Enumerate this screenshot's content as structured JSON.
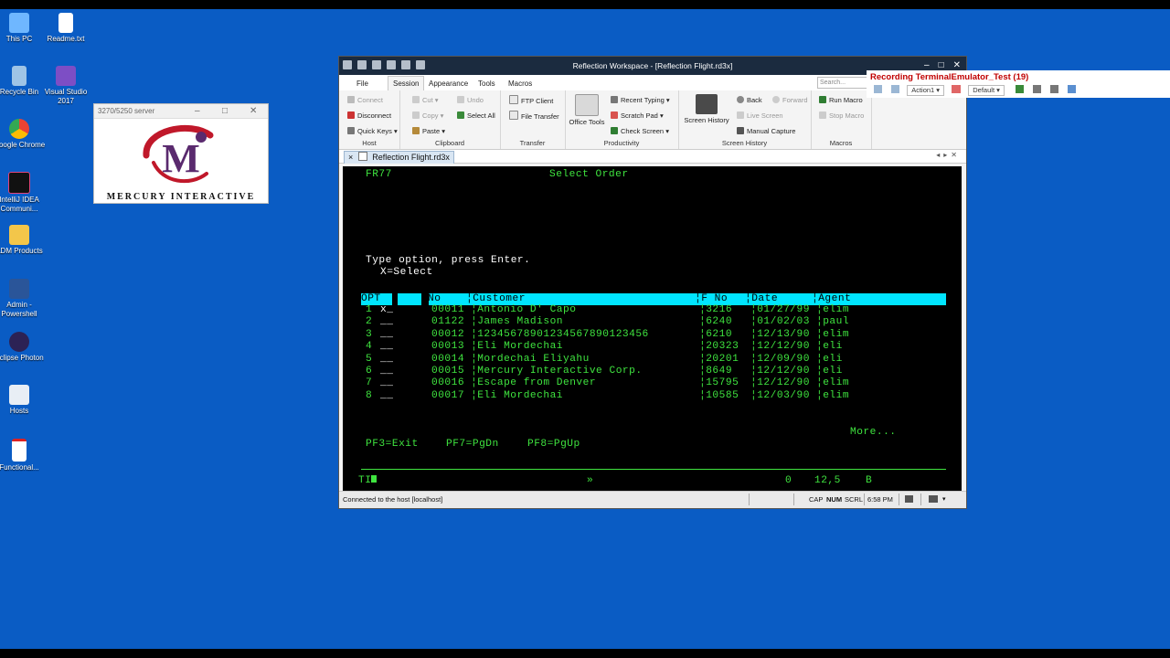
{
  "desktop": {
    "icons": [
      {
        "label": "This PC"
      },
      {
        "label": "Readme.txt"
      },
      {
        "label": "Recycle Bin"
      },
      {
        "label": "Visual Studio 2017"
      },
      {
        "label": "Google Chrome"
      },
      {
        "label": "IntelliJ IDEA Communi..."
      },
      {
        "label": "ADM Products"
      },
      {
        "label": "Admin - Powershell"
      },
      {
        "label": "Eclipse Photon"
      },
      {
        "label": "Hosts"
      },
      {
        "label": "Functional..."
      }
    ],
    "colors": {
      "background": "#0a5cc4"
    }
  },
  "splash": {
    "caption": "3270/5250 server",
    "brand": "MERCURY INTERACTIVE",
    "logo_letter": "M"
  },
  "window": {
    "title": "Reflection Workspace - [Reflection Flight.rd3x]",
    "controls": {
      "minimize": "–",
      "maximize": "□",
      "close": "✕"
    },
    "menu_tabs": [
      {
        "label": "File"
      },
      {
        "label": "Session"
      },
      {
        "label": "Appearance"
      },
      {
        "label": "Tools"
      },
      {
        "label": "Macros"
      }
    ],
    "active_tab": "Session",
    "search_placeholder": "Search..."
  },
  "ribbon": {
    "host": {
      "label": "Host",
      "connect": "Connect",
      "disconnect": "Disconnect",
      "quick_keys": "Quick Keys"
    },
    "clipboard": {
      "label": "Clipboard",
      "cut": "Cut",
      "copy": "Copy",
      "paste": "Paste",
      "undo": "Undo",
      "select_all": "Select All"
    },
    "transfer": {
      "label": "Transfer",
      "ftp_client": "FTP Client",
      "file_transfer": "File Transfer"
    },
    "productivity": {
      "label": "Productivity",
      "office_tools": "Office Tools",
      "recent_typing": "Recent Typing",
      "scratch_pad": "Scratch Pad",
      "check_screen": "Check Screen"
    },
    "screen_history": {
      "label": "Screen History",
      "screen_history_btn": "Screen History",
      "back": "Back",
      "forward": "Forward",
      "live_screen": "Live Screen",
      "manual_capture": "Manual Capture"
    },
    "macros": {
      "label": "Macros",
      "run_macro": "Run Macro",
      "stop_macro": "Stop Macro"
    }
  },
  "document_tab": {
    "label": "Reflection Flight.rd3x",
    "close": "×"
  },
  "terminal": {
    "screen_id": "FR77",
    "screen_title": "Select Order",
    "instruction": "Type option, press Enter.",
    "option_hint": "X=Select",
    "columns": {
      "opt": "OPT",
      "no": "No",
      "customer": "¦Customer",
      "fno": "¦F No",
      "date": "¦Date",
      "agent": "¦Agent"
    },
    "rows": [
      {
        "num": "1",
        "opt": "x_",
        "no": "00011",
        "customer": "¦Antonio D' Capo",
        "fno": "¦3216",
        "date": "¦01/27/99",
        "agent": "¦elim"
      },
      {
        "num": "2",
        "opt": "__",
        "no": "01122",
        "customer": "¦James Madison",
        "fno": "¦6240",
        "date": "¦01/02/03",
        "agent": "¦paul"
      },
      {
        "num": "3",
        "opt": "__",
        "no": "00012",
        "customer": "¦12345678901234567890123456",
        "fno": "¦6210",
        "date": "¦12/13/90",
        "agent": "¦elim"
      },
      {
        "num": "4",
        "opt": "__",
        "no": "00013",
        "customer": "¦Eli Mordechai",
        "fno": "¦20323",
        "date": "¦12/12/90",
        "agent": "¦eli"
      },
      {
        "num": "5",
        "opt": "__",
        "no": "00014",
        "customer": "¦Mordechai Eliyahu",
        "fno": "¦20201",
        "date": "¦12/09/90",
        "agent": "¦eli"
      },
      {
        "num": "6",
        "opt": "__",
        "no": "00015",
        "customer": "¦Mercury Interactive Corp.",
        "fno": "¦8649",
        "date": "¦12/12/90",
        "agent": "¦eli"
      },
      {
        "num": "7",
        "opt": "__",
        "no": "00016",
        "customer": "¦Escape from Denver",
        "fno": "¦15795",
        "date": "¦12/12/90",
        "agent": "¦elim"
      },
      {
        "num": "8",
        "opt": "__",
        "no": "00017",
        "customer": "¦Eli Mordechai",
        "fno": "¦10585",
        "date": "¦12/03/90",
        "agent": "¦elim"
      }
    ],
    "more": "More...",
    "function_keys": {
      "pf3": "PF3=Exit",
      "pf7": "PF7=PgDn",
      "pf8": "PF8=PgUp"
    },
    "oia": {
      "left": "TI",
      "mid": "»",
      "cursor_col": "0",
      "cursor_pos": "12,5",
      "mode": "B"
    },
    "colors": {
      "text": "#3fe43f",
      "header": "#00e5ff",
      "background": "#000000"
    }
  },
  "status_bar": {
    "connection": "Connected to the host [localhost]",
    "cap": "CAP",
    "num": "NUM",
    "scrl": "SCRL",
    "time": "6:58 PM"
  },
  "recorder": {
    "title": "Recording TerminalEmulator_Test (19)",
    "action": "Action1",
    "profile": "Default"
  }
}
